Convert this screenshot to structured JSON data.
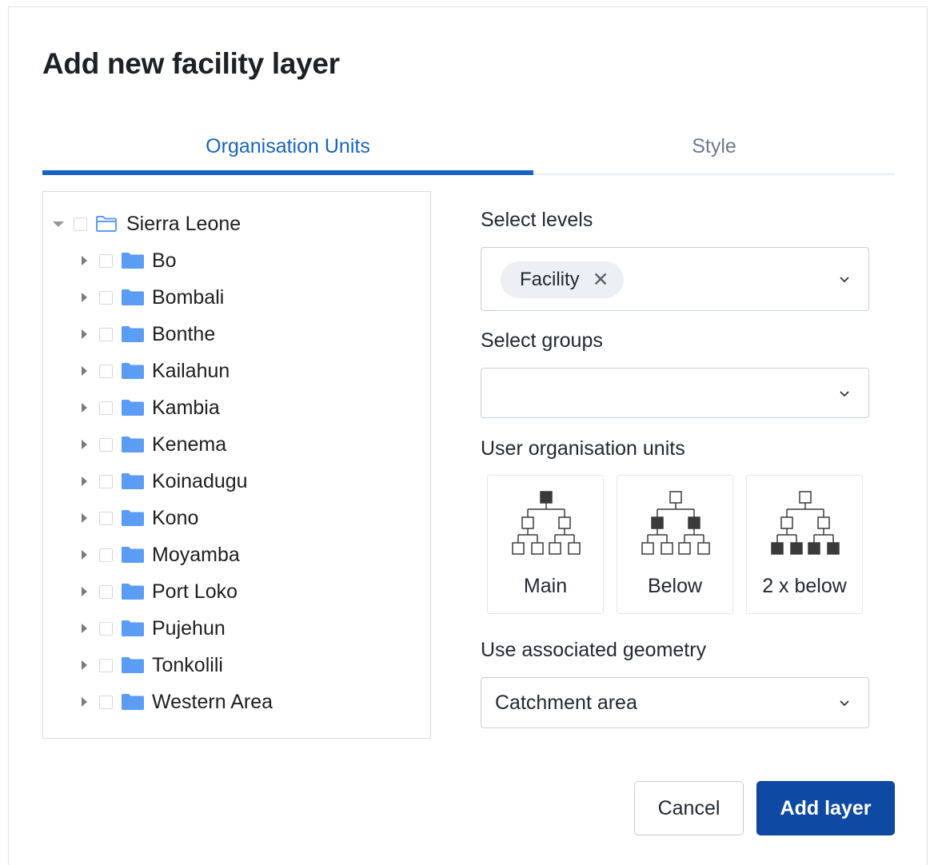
{
  "dialog": {
    "title": "Add new facility layer"
  },
  "tabs": [
    {
      "label": "Organisation Units",
      "active": true
    },
    {
      "label": "Style",
      "active": false
    }
  ],
  "tree": {
    "root": {
      "label": "Sierra Leone",
      "expanded": true,
      "checked": false
    },
    "children": [
      {
        "label": "Bo",
        "checked": false
      },
      {
        "label": "Bombali",
        "checked": false
      },
      {
        "label": "Bonthe",
        "checked": false
      },
      {
        "label": "Kailahun",
        "checked": false
      },
      {
        "label": "Kambia",
        "checked": false
      },
      {
        "label": "Kenema",
        "checked": false
      },
      {
        "label": "Koinadugu",
        "checked": false
      },
      {
        "label": "Kono",
        "checked": false
      },
      {
        "label": "Moyamba",
        "checked": false
      },
      {
        "label": "Port Loko",
        "checked": false
      },
      {
        "label": "Pujehun",
        "checked": false
      },
      {
        "label": "Tonkolili",
        "checked": false
      },
      {
        "label": "Western Area",
        "checked": false
      }
    ]
  },
  "levels": {
    "label": "Select levels",
    "selected": [
      "Facility"
    ]
  },
  "groups": {
    "label": "Select groups",
    "value": ""
  },
  "user_units": {
    "label": "User organisation units",
    "options": [
      {
        "label": "Main",
        "icon": "hierarchy-main-icon"
      },
      {
        "label": "Below",
        "icon": "hierarchy-below-icon"
      },
      {
        "label": "2 x below",
        "icon": "hierarchy-2x-below-icon"
      }
    ]
  },
  "geometry": {
    "label": "Use associated geometry",
    "value": "Catchment area"
  },
  "actions": {
    "cancel": "Cancel",
    "add": "Add layer"
  },
  "colors": {
    "primary": "#1565c0",
    "primary_button": "#0e4aa3",
    "folder": "#5b9cf4"
  }
}
